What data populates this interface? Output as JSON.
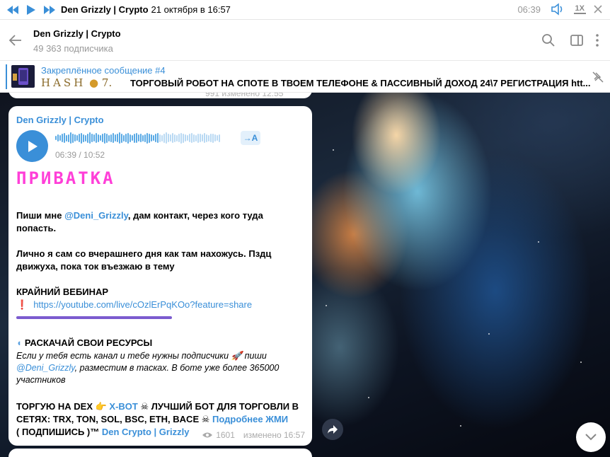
{
  "player": {
    "title": "Den Grizzly | Crypto",
    "date": "21 октября в 16:57",
    "time": "06:39",
    "speed": "1X"
  },
  "header": {
    "channel_name": "Den Grizzly | Crypto",
    "subscribers": "49 363 подписчика"
  },
  "pinned": {
    "label": "Закреплённое сообщение #4",
    "brand": "HASH",
    "brand_suffix": "7.",
    "text": "ТОРГОВЫЙ РОБОТ НА СПОТЕ В ТВОЕМ ТЕЛЕФОНЕ & ПАССИВНЫЙ ДОХОД 24\\7  РЕГИСТРАЦИЯ htt..."
  },
  "prev_message": {
    "meta": "991  изменено 12:55"
  },
  "message": {
    "author": "Den Grizzly | Crypto",
    "voice": {
      "duration": "06:39 / 10:52",
      "transcribe_label": "→A",
      "waveform": [
        6,
        10,
        8,
        12,
        14,
        9,
        11,
        16,
        13,
        10,
        8,
        12,
        15,
        11,
        9,
        13,
        16,
        12,
        10,
        14,
        11,
        8,
        12,
        15,
        13,
        9,
        11,
        14,
        10,
        12,
        16,
        13,
        9,
        12,
        15,
        11,
        8,
        13,
        14,
        10,
        12,
        9,
        11,
        15,
        13,
        10,
        8,
        12,
        14,
        11,
        9,
        13,
        16,
        12,
        10,
        14,
        11,
        9,
        12,
        15,
        13,
        10,
        8,
        12,
        14,
        11,
        9,
        13,
        12,
        10,
        14,
        11,
        9,
        12,
        13,
        10,
        8,
        11
      ]
    },
    "privatka": "ПРИВАТКА",
    "p1_a": "Пиши мне ",
    "p1_link": "@Deni_Grizzly",
    "p1_b": ", дам контакт, через кого туда попасть.",
    "p2": "Лично я сам со вчерашнего дня как там нахожусь. Пздц движуха, пока ток въезжаю в тему",
    "webinar_title": "КРАЙНИЙ ВЕБИНАР",
    "webinar_link": "https://youtube.com/live/cOzlErPqKOo?feature=share",
    "boost_title": "РАСКАЧАЙ СВОИ РЕСУРСЫ",
    "boost_a": "Если у тебя есть канал и тебе нужны подписчики ",
    "boost_b": " пиши ",
    "boost_link": "@Deni_Grizzly",
    "boost_c": ", разместим в тасках. В боте уже более 365000 участников",
    "dex_a": "ТОРГУЮ НА DEX ",
    "dex_link": "X-BOT",
    "dex_b": " ЛУЧШИЙ БОТ ДЛЯ ТОРГОВЛИ В СЕТЯХ: TRX, TON, SOL, BSC, ETH, BACE ",
    "dex_link2": "Подробнее ЖМИ",
    "sub_a": "( ПОДПИШИСЬ )™ ",
    "sub_link": "Den Crypto | Grizzly",
    "views": "1601",
    "edited": "изменено 16:57"
  }
}
